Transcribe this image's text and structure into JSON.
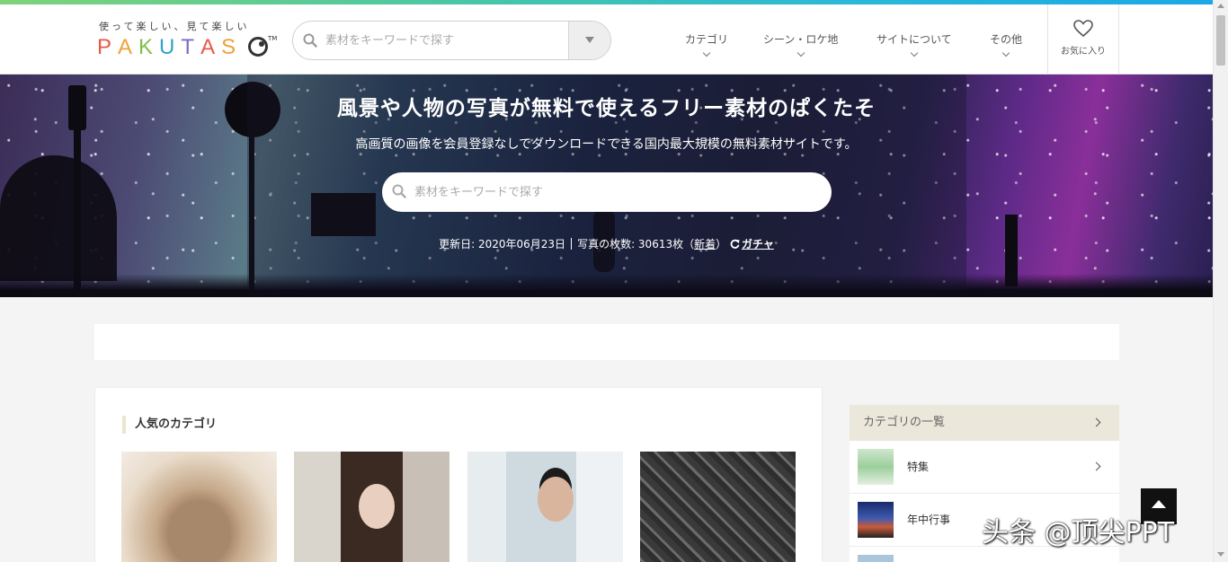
{
  "header": {
    "logo_tagline": "使って楽しい、見て楽しい",
    "logo_letters": [
      "P",
      "A",
      "K",
      "U",
      "T",
      "A",
      "S"
    ],
    "logo_letter_colors": [
      "#e8584a",
      "#f0a13a",
      "#7fbf4d",
      "#2ea3c8",
      "#7a6bc8",
      "#e8584a",
      "#f0a13a"
    ],
    "logo_tm": "TM",
    "search_placeholder": "素材をキーワードで探す",
    "nav": [
      {
        "label": "カテゴリ"
      },
      {
        "label": "シーン・ロケ地"
      },
      {
        "label": "サイトについて"
      },
      {
        "label": "その他"
      }
    ],
    "favorites_label": "お気に入り"
  },
  "hero": {
    "title": "風景や人物の写真が無料で使えるフリー素材のぱくたそ",
    "subtitle": "高画質の画像を会員登録なしでダウンロードできる国内最大規模の無料素材サイトです。",
    "search_placeholder": "素材をキーワードで探す",
    "updated": "更新日: 2020年06月23日",
    "photo_count": "写真の枚数: 30613枚（",
    "new_link": "新着",
    "photo_count_close": "）",
    "gacha": "ガチャ"
  },
  "main": {
    "section_title": "人気のカテゴリ"
  },
  "sidebar": {
    "heading": "カテゴリの一覧",
    "items": [
      {
        "label": "特集"
      },
      {
        "label": "年中行事"
      }
    ]
  },
  "watermark": "头条 @顶尖PPT",
  "colors": {
    "accent_top_strip": "#2ab8d8",
    "sidebar_head_bg": "#ece7db",
    "page_bg": "#f4f4f4"
  }
}
